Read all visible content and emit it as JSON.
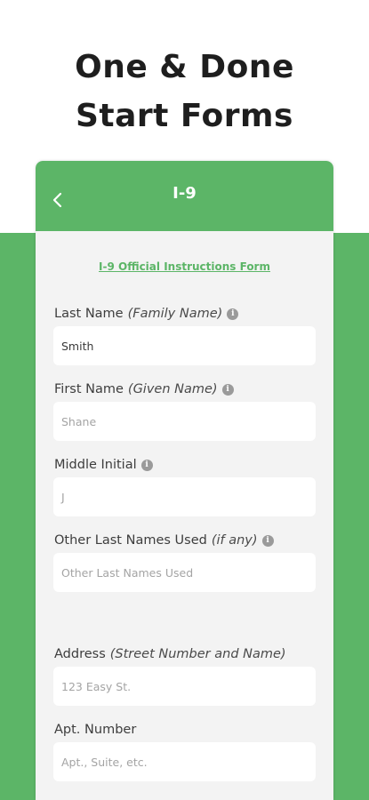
{
  "headline": {
    "line1": "One & Done",
    "line2": "Start Forms"
  },
  "app": {
    "title": "I-9",
    "back_icon": "chevron-left-icon",
    "instructions_link": "I-9 Official Instructions Form"
  },
  "colors": {
    "brand_green": "#5cb567",
    "form_bg": "#f3f3f3"
  },
  "fields": [
    {
      "label": "Last Name",
      "hint": "(Family Name)",
      "info": true,
      "value": "Smith",
      "is_placeholder": false
    },
    {
      "label": "First Name",
      "hint": "(Given Name)",
      "info": true,
      "value": "Shane",
      "is_placeholder": true
    },
    {
      "label": "Middle Initial",
      "hint": "",
      "info": true,
      "value": "J",
      "is_placeholder": true
    },
    {
      "label": "Other Last Names Used",
      "hint": "(if any)",
      "info": true,
      "value": "Other Last Names Used",
      "is_placeholder": true
    },
    {
      "label": "Address",
      "hint": "(Street Number and Name)",
      "info": false,
      "value": "123 Easy St.",
      "is_placeholder": true
    },
    {
      "label": "Apt. Number",
      "hint": "",
      "info": false,
      "value": "Apt., Suite, etc.",
      "is_placeholder": true
    }
  ]
}
